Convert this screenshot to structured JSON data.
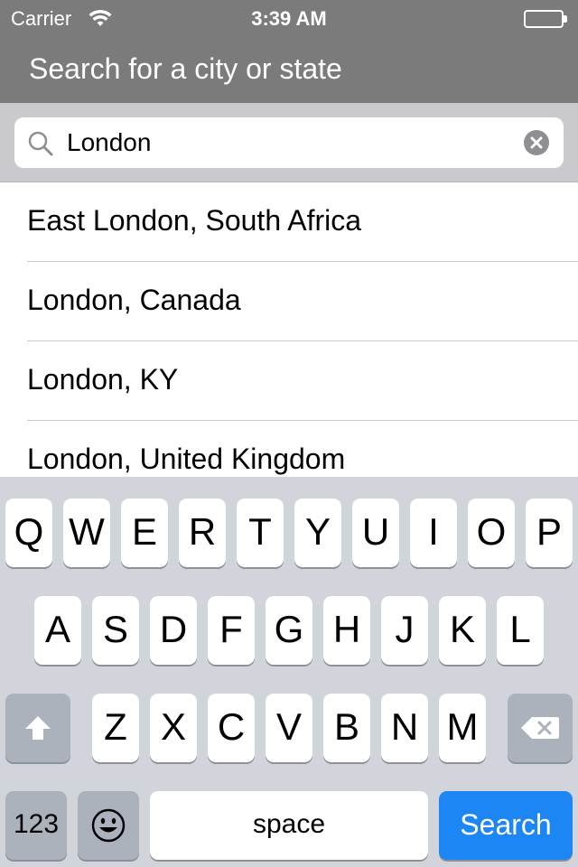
{
  "status_bar": {
    "carrier": "Carrier",
    "time": "3:39 AM",
    "battery_level": 1.0
  },
  "nav": {
    "title": "Search for a city or state"
  },
  "search": {
    "value": "London",
    "search_icon": "magnifier-icon",
    "clear_icon": "clear-circle-x-icon"
  },
  "results": [
    {
      "label": "East London, South Africa"
    },
    {
      "label": "London, Canada"
    },
    {
      "label": "London, KY"
    },
    {
      "label": "London, United Kingdom"
    }
  ],
  "keyboard": {
    "row1": [
      "Q",
      "W",
      "E",
      "R",
      "T",
      "Y",
      "U",
      "I",
      "O",
      "P"
    ],
    "row2": [
      "A",
      "S",
      "D",
      "F",
      "G",
      "H",
      "J",
      "K",
      "L"
    ],
    "row3": [
      "Z",
      "X",
      "C",
      "V",
      "B",
      "N",
      "M"
    ],
    "numbers_label": "123",
    "space_label": "space",
    "search_label": "Search",
    "shift_icon": "shift-arrow-icon",
    "delete_icon": "backspace-icon",
    "emoji_icon": "emoji-face-icon",
    "accent_color": "#1d86f5"
  },
  "colors": {
    "nav_background": "#7b7b7b",
    "search_background": "#c9c9ce",
    "keyboard_background": "#d1d5db"
  }
}
